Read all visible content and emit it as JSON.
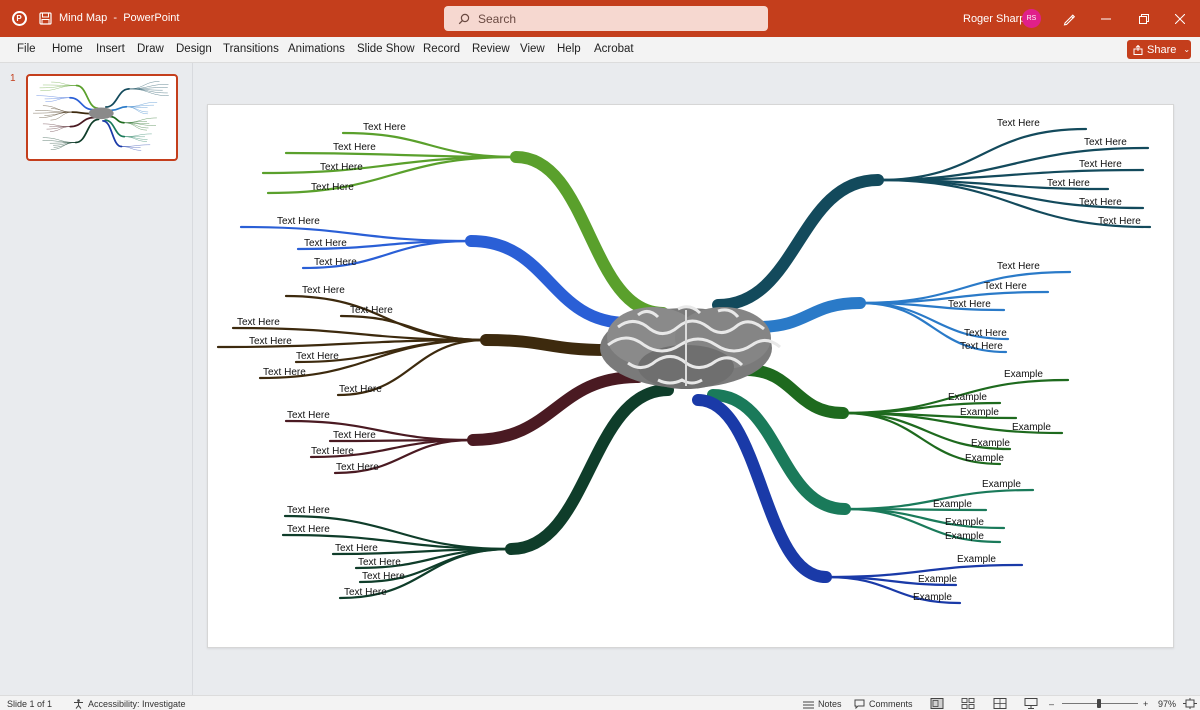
{
  "app": {
    "document_name": "Mind Map",
    "app_name": "PowerPoint",
    "title_separator": "-",
    "search_placeholder": "Search",
    "user_name": "Roger Sharp",
    "user_initials": "RS"
  },
  "menu": {
    "items": [
      "File",
      "Home",
      "Insert",
      "Draw",
      "Design",
      "Transitions",
      "Animations",
      "Slide Show",
      "Record",
      "Review",
      "View",
      "Help",
      "Acrobat"
    ],
    "share_label": "Share"
  },
  "thumbnails": {
    "slide_number": "1"
  },
  "mindmap": {
    "center_icon": "brain-icon",
    "left_branches": [
      {
        "color": "#5aa02c",
        "labels": [
          "Text Here",
          "Text Here",
          "Text Here",
          "Text Here"
        ]
      },
      {
        "color": "#2a5fd6",
        "labels": [
          "Text Here",
          "Text Here",
          "Text Here"
        ]
      },
      {
        "color": "#3d2a0e",
        "labels": [
          "Text Here",
          "Text Here",
          "Text Here",
          "Text Here",
          "Text Here",
          "Text Here",
          "Text Here"
        ]
      },
      {
        "color": "#4a1a22",
        "labels": [
          "Text Here",
          "Text Here",
          "Text Here",
          "Text Here"
        ]
      },
      {
        "color": "#0f3d2a",
        "labels": [
          "Text Here",
          "Text Here",
          "Text Here",
          "Text Here",
          "Text Here",
          "Text Here"
        ]
      }
    ],
    "right_branches": [
      {
        "color": "#134a5c",
        "labels": [
          "Text Here",
          "Text Here",
          "Text Here",
          "Text Here",
          "Text Here",
          "Text Here"
        ]
      },
      {
        "color": "#2a7ac8",
        "labels": [
          "Text Here",
          "Text Here",
          "Text Here",
          "Text Here",
          "Text Here"
        ]
      },
      {
        "color": "#1e6a1e",
        "labels": [
          "Example",
          "Example",
          "Example",
          "Example",
          "Example",
          "Example"
        ]
      },
      {
        "color": "#1a7a5a",
        "labels": [
          "Example",
          "Example",
          "Example",
          "Example"
        ]
      },
      {
        "color": "#1a3aa8",
        "labels": [
          "Example",
          "Example",
          "Example"
        ]
      }
    ]
  },
  "status": {
    "slide_info": "Slide 1 of 1",
    "accessibility": "Accessibility: Investigate",
    "notes_label": "Notes",
    "comments_label": "Comments",
    "zoom_level": "97%",
    "zoom_minus": "–",
    "zoom_plus": "+"
  },
  "colors": {
    "accent": "#c43e1c",
    "avatar": "#e0208a"
  }
}
